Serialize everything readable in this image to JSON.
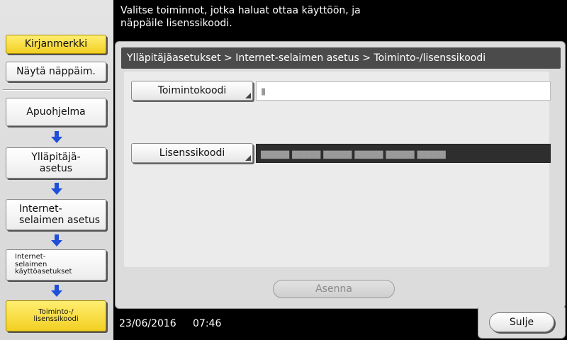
{
  "message": "Valitse toiminnot, jotka haluat ottaa käyttöön, ja\nnäppäile lisenssikoodi.",
  "sidebar": {
    "bookmark_label": "Kirjanmerkki",
    "keypad_label": "Näytä näppäim.",
    "path": [
      {
        "label": "Apuohjelma"
      },
      {
        "label": "Ylläpitäjä-\nasetus"
      },
      {
        "label": "Internet-\nselaimen asetus"
      },
      {
        "label": "Internet-\nselaimen\nkäyttöasetukset"
      },
      {
        "label": "Toiminto-/\nlisenssikoodi"
      }
    ]
  },
  "breadcrumb": "Ylläpitäjäasetukset > Internet-selaimen asetus > Toiminto-/lisenssikoodi",
  "fields": {
    "function_code_label": "Toimintokoodi",
    "function_code_value": "▮",
    "license_code_label": "Lisenssikoodi",
    "license_code_value": "▆▆▆▆ ▆▆▆▆ ▆▆▆▆ ▆▆▆▆ ▆▆▆▆ ▆▆▆▆"
  },
  "install_label": "Asenna",
  "status": {
    "date": "23/06/2016",
    "time": "07:46"
  },
  "close_label": "Sulje",
  "colors": {
    "active_yellow": "#f6d42a",
    "breadcrumb_bg": "#4b4b4b",
    "arrow_blue": "#1f4fd8"
  }
}
